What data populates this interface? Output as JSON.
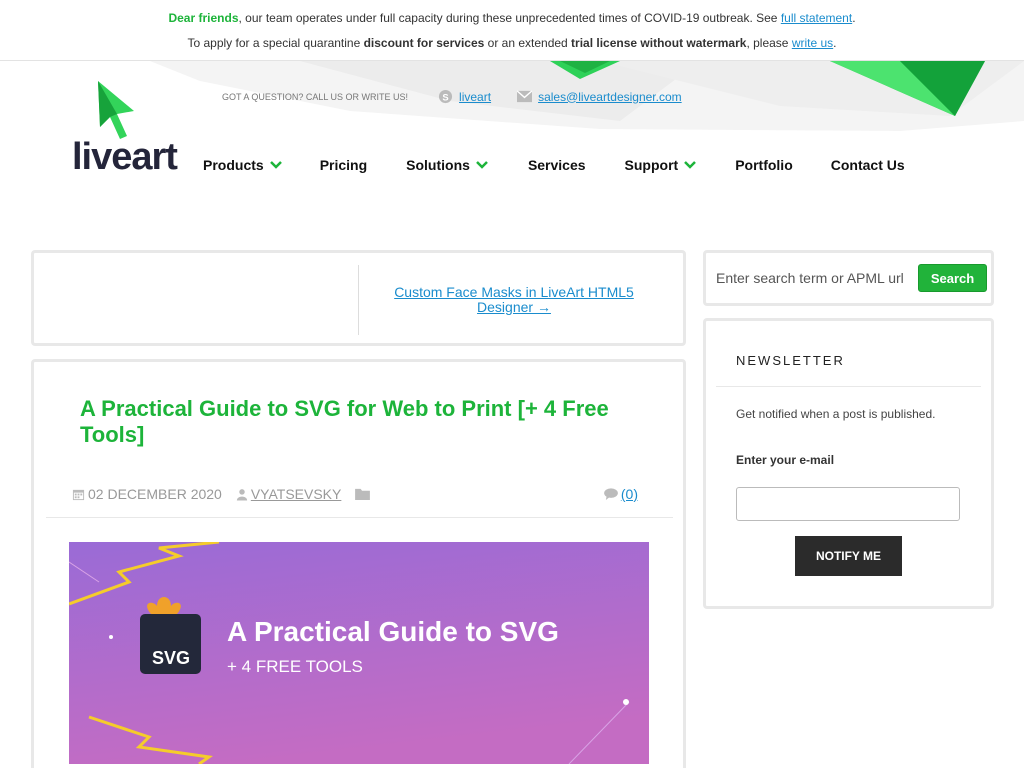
{
  "notice": {
    "line1_green": "Dear friends",
    "line1_text": ", our team operates under full capacity during these unprecedented times of COVID-19 outbreak. See ",
    "line1_link": "full statement",
    "line1_end": ".",
    "line2_a": "To apply for a special quarantine ",
    "line2_b": "discount for services",
    "line2_c": " or an extended ",
    "line2_d": "trial license without watermark",
    "line2_e": ", please ",
    "line2_link": "write us",
    "line2_end": "."
  },
  "header": {
    "logo_text": "liveart",
    "question": "Got a question? Call us or write us!",
    "skype": "liveart",
    "email": "sales@liveartdesigner.com"
  },
  "nav": {
    "items": [
      {
        "label": "Products",
        "dropdown": true
      },
      {
        "label": "Pricing",
        "dropdown": false
      },
      {
        "label": "Solutions",
        "dropdown": true
      },
      {
        "label": "Services",
        "dropdown": false
      },
      {
        "label": "Support",
        "dropdown": true
      },
      {
        "label": "Portfolio",
        "dropdown": false
      },
      {
        "label": "Contact Us",
        "dropdown": false
      }
    ]
  },
  "post_nav": {
    "next": "Custom Face Masks in LiveArt HTML5 Designer →"
  },
  "post": {
    "title": "A Practical Guide to SVG for Web to Print [+ 4 Free Tools]",
    "date": "02 DECEMBER 2020",
    "author": "VYATSEVSKY",
    "comments": "(0)",
    "banner_title": "A Practical Guide to SVG",
    "banner_sub": "+ 4 FREE TOOLS",
    "banner_badge": "SVG"
  },
  "search": {
    "placeholder": "Enter search term or APML url",
    "button": "Search"
  },
  "newsletter": {
    "title": "NEWSLETTER",
    "desc": "Get notified when a post is published.",
    "label": "Enter your e-mail",
    "button": "NOTIFY ME"
  },
  "colors": {
    "brand_green": "#1db43a",
    "link_blue": "#1a8ccd",
    "dark": "#2b2b2b"
  }
}
